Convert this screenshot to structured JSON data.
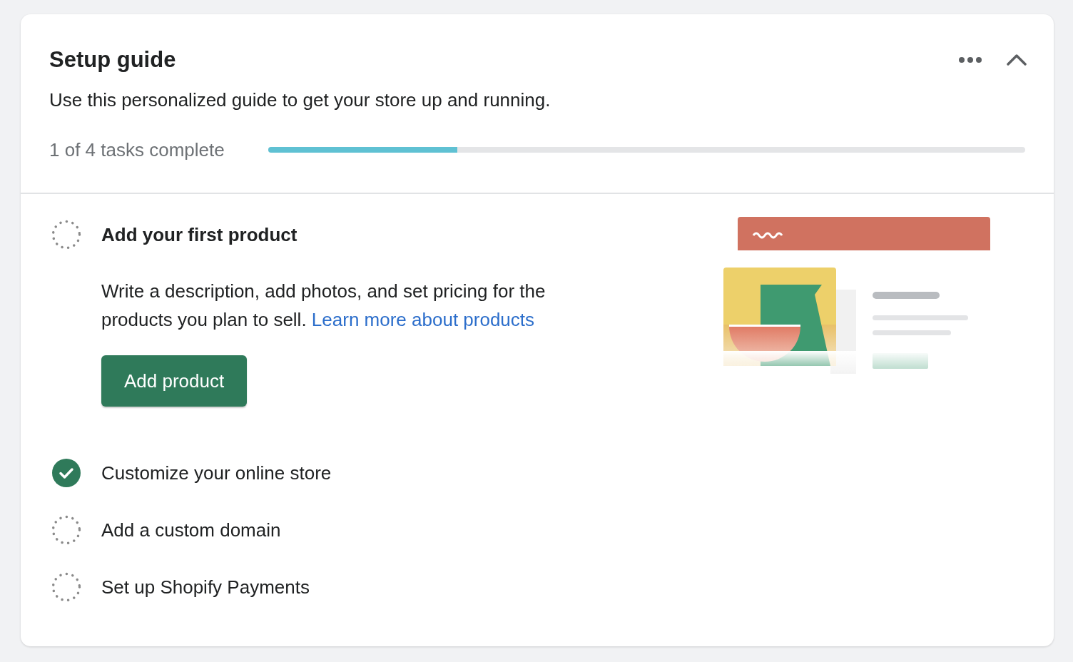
{
  "card": {
    "title": "Setup guide",
    "subtitle": "Use this personalized guide to get your store up and running.",
    "expanded": true
  },
  "progress": {
    "label": "1 of 4 tasks complete",
    "level": 0.25
  },
  "tasks": [
    {
      "title": "Add your first product",
      "completed": false,
      "expanded": true,
      "description": "Write a description, add photos, and set pricing for the products you plan to sell.",
      "link": "Learn more about products",
      "button": "Add product"
    },
    {
      "title": "Customize your online store",
      "completed": true,
      "expanded": false
    },
    {
      "title": "Add a custom domain",
      "completed": false,
      "expanded": false
    },
    {
      "title": "Set up Shopify Payments",
      "completed": false,
      "expanded": false
    }
  ]
}
